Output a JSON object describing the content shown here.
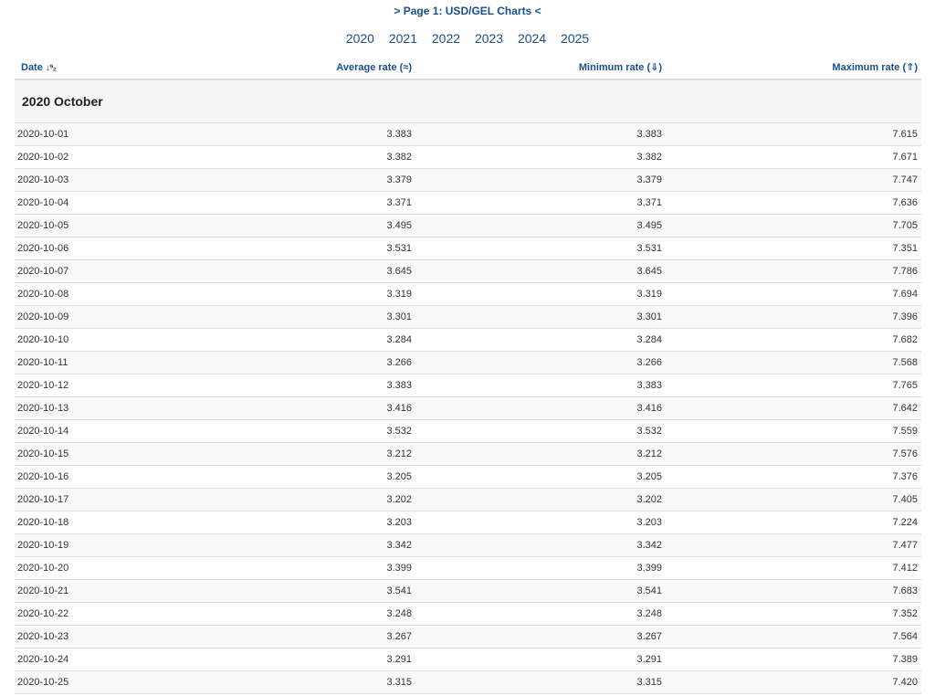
{
  "page_link": "> Page 1: USD/GEL Charts <",
  "years": [
    "2020",
    "2021",
    "2022",
    "2023",
    "2024",
    "2025"
  ],
  "table": {
    "headers": {
      "date": "Date",
      "average": "Average rate (≈)",
      "minimum": "Minimum rate (⇓)",
      "maximum": "Maximum rate (⇑)"
    },
    "sort_icon": "sort-ascending-icon",
    "month_title": "2020 October",
    "rows": [
      [
        "2020-10-01",
        "3.383",
        "3.383",
        "7.615"
      ],
      [
        "2020-10-02",
        "3.382",
        "3.382",
        "7.671"
      ],
      [
        "2020-10-03",
        "3.379",
        "3.379",
        "7.747"
      ],
      [
        "2020-10-04",
        "3.371",
        "3.371",
        "7.636"
      ],
      [
        "2020-10-05",
        "3.495",
        "3.495",
        "7.705"
      ],
      [
        "2020-10-06",
        "3.531",
        "3.531",
        "7.351"
      ],
      [
        "2020-10-07",
        "3.645",
        "3.645",
        "7.786"
      ],
      [
        "2020-10-08",
        "3.319",
        "3.319",
        "7.694"
      ],
      [
        "2020-10-09",
        "3.301",
        "3.301",
        "7.396"
      ],
      [
        "2020-10-10",
        "3.284",
        "3.284",
        "7.682"
      ],
      [
        "2020-10-11",
        "3.266",
        "3.266",
        "7.568"
      ],
      [
        "2020-10-12",
        "3.383",
        "3.383",
        "7.765"
      ],
      [
        "2020-10-13",
        "3.416",
        "3.416",
        "7.642"
      ],
      [
        "2020-10-14",
        "3.532",
        "3.532",
        "7.559"
      ],
      [
        "2020-10-15",
        "3.212",
        "3.212",
        "7.576"
      ],
      [
        "2020-10-16",
        "3.205",
        "3.205",
        "7.376"
      ],
      [
        "2020-10-17",
        "3.202",
        "3.202",
        "7.405"
      ],
      [
        "2020-10-18",
        "3.203",
        "3.203",
        "7.224"
      ],
      [
        "2020-10-19",
        "3.342",
        "3.342",
        "7.477"
      ],
      [
        "2020-10-20",
        "3.399",
        "3.399",
        "7.412"
      ],
      [
        "2020-10-21",
        "3.541",
        "3.541",
        "7.683"
      ],
      [
        "2020-10-22",
        "3.248",
        "3.248",
        "7.352"
      ],
      [
        "2020-10-23",
        "3.267",
        "3.267",
        "7.564"
      ],
      [
        "2020-10-24",
        "3.291",
        "3.291",
        "7.389"
      ],
      [
        "2020-10-25",
        "3.315",
        "3.315",
        "7.420"
      ]
    ]
  },
  "colors": {
    "link": "#1a4f8b",
    "text": "#333333",
    "month_bg": "#f5f5f5",
    "border": "#dddddd"
  }
}
